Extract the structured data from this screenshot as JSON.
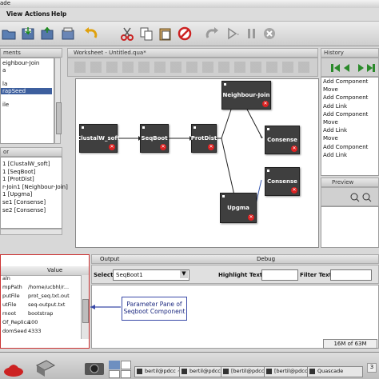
{
  "app": {
    "title_fragment": "ade"
  },
  "menu": [
    "View",
    "Actions",
    "Help"
  ],
  "toolbar_icons": [
    "open-icon",
    "save-icon",
    "export-icon",
    "undo-icon",
    "cut-icon",
    "copy-icon",
    "paste-icon",
    "stop-icon",
    "redo-icon",
    "run-icon",
    "pause-icon",
    "cancel-icon"
  ],
  "components_panel": {
    "header": "ments",
    "items": [
      "eighbour-Join",
      "a",
      "",
      "la",
      "rapSeed",
      "",
      "ile",
      "",
      "",
      "",
      "",
      ""
    ],
    "selected_index": 4
  },
  "editor_panel": {
    "header": "or",
    "items": [
      "1 [ClustalW_soft]",
      "1 [SeqBoot]",
      "1 [ProtDist]",
      "r-Join1 [Neighbour-Join]",
      "1 [Upgma]",
      "se1 [Consense]",
      "se2 [Consense]"
    ]
  },
  "worksheet": {
    "title": "Worksheet - Untitled.qua*"
  },
  "nodes": {
    "clustalw": "ClustalW_soft",
    "seqboot": "SeqBoot",
    "protdist": "ProtDist",
    "neighbour": "Neighbour-Join",
    "consense1": "Consense",
    "consense2": "Consense",
    "upgma": "Upgma"
  },
  "history": {
    "header": "History",
    "items": [
      "Add Component",
      "Move",
      "Add Component",
      "Add Link",
      "Add Component",
      "Move",
      "Add Link",
      "Move",
      "Add Component",
      "Add Link"
    ]
  },
  "preview": {
    "header": "Preview"
  },
  "params": {
    "col_value": "Value",
    "rows": [
      {
        "name": "aln",
        "value": ""
      },
      {
        "name": "mpPath",
        "value": "/home/ucbhl/r..."
      },
      {
        "name": "putFile",
        "value": "prot_seq.txt.out"
      },
      {
        "name": "utFile",
        "value": "seq-output.txt"
      },
      {
        "name": "rnoot",
        "value": "bootstrap"
      },
      {
        "name": "Of_Replica",
        "value": "100"
      },
      {
        "name": "domSeed",
        "value": "4333"
      }
    ]
  },
  "output_tabs": {
    "output": "Output",
    "debug": "Debug"
  },
  "select_row": {
    "select_label": "Select:",
    "select_value": "SeqBoot1",
    "highlight_label": "Highlight Text",
    "filter_label": "Filter Text"
  },
  "annotation": {
    "line1": "Parameter Pane of",
    "line2": "Seqboot Component"
  },
  "memory": "16M of 63M",
  "taskbar": {
    "tasks": [
      "bertil@pdcc ~/ymp2instal/",
      "bertil@pdcc ~/ymp2instal/",
      "[bertil@pdcc ~/rahul]",
      "[bertil@pdcc ~/rahulphylo",
      "Quascade"
    ],
    "page_counter": "3"
  },
  "colors": {
    "node": "#3f3f3f",
    "annotation_border": "#3a4aa8",
    "params_border": "#cc3333",
    "accent_green": "#2a8a2a"
  }
}
